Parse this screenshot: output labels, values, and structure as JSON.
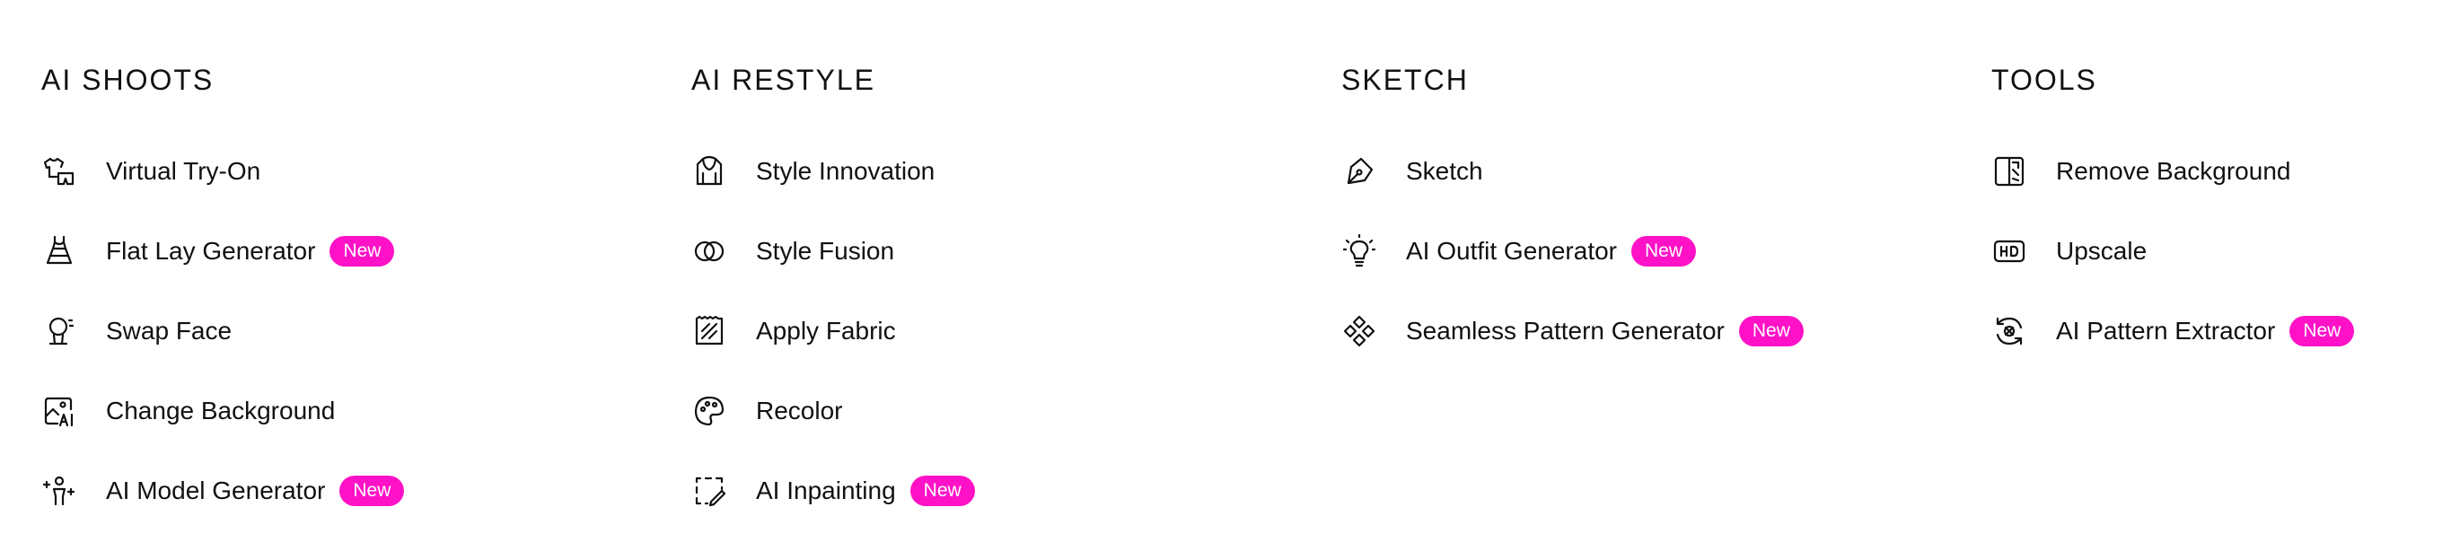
{
  "new_badge": "New",
  "accent_color": "#ff12c7",
  "sections": [
    {
      "title": "AI SHOOTS",
      "items": [
        {
          "label": "Virtual Try-On",
          "icon": "clothes-icon",
          "is_new": false
        },
        {
          "label": "Flat Lay Generator",
          "icon": "dress-icon",
          "is_new": true
        },
        {
          "label": "Swap Face",
          "icon": "face-icon",
          "is_new": false
        },
        {
          "label": "Change Background",
          "icon": "ai-image-icon",
          "is_new": false
        },
        {
          "label": "AI Model Generator",
          "icon": "sparkle-person-icon",
          "is_new": true
        }
      ]
    },
    {
      "title": "AI RESTYLE",
      "items": [
        {
          "label": "Style Innovation",
          "icon": "hoodie-icon",
          "is_new": false
        },
        {
          "label": "Style Fusion",
          "icon": "overlap-circles-icon",
          "is_new": false
        },
        {
          "label": "Apply Fabric",
          "icon": "fabric-icon",
          "is_new": false
        },
        {
          "label": "Recolor",
          "icon": "palette-icon",
          "is_new": false
        },
        {
          "label": "AI Inpainting",
          "icon": "inpaint-brush-icon",
          "is_new": true
        }
      ]
    },
    {
      "title": "SKETCH",
      "items": [
        {
          "label": "Sketch",
          "icon": "pen-nib-icon",
          "is_new": false
        },
        {
          "label": "AI Outfit Generator",
          "icon": "lightbulb-icon",
          "is_new": true
        },
        {
          "label": "Seamless Pattern Generator",
          "icon": "diamond-pattern-icon",
          "is_new": true
        }
      ]
    },
    {
      "title": "TOOLS",
      "items": [
        {
          "label": "Remove Background",
          "icon": "remove-bg-icon",
          "is_new": false
        },
        {
          "label": "Upscale",
          "icon": "hd-icon",
          "is_new": false
        },
        {
          "label": "AI Pattern Extractor",
          "icon": "pattern-extract-icon",
          "is_new": true
        }
      ]
    }
  ]
}
